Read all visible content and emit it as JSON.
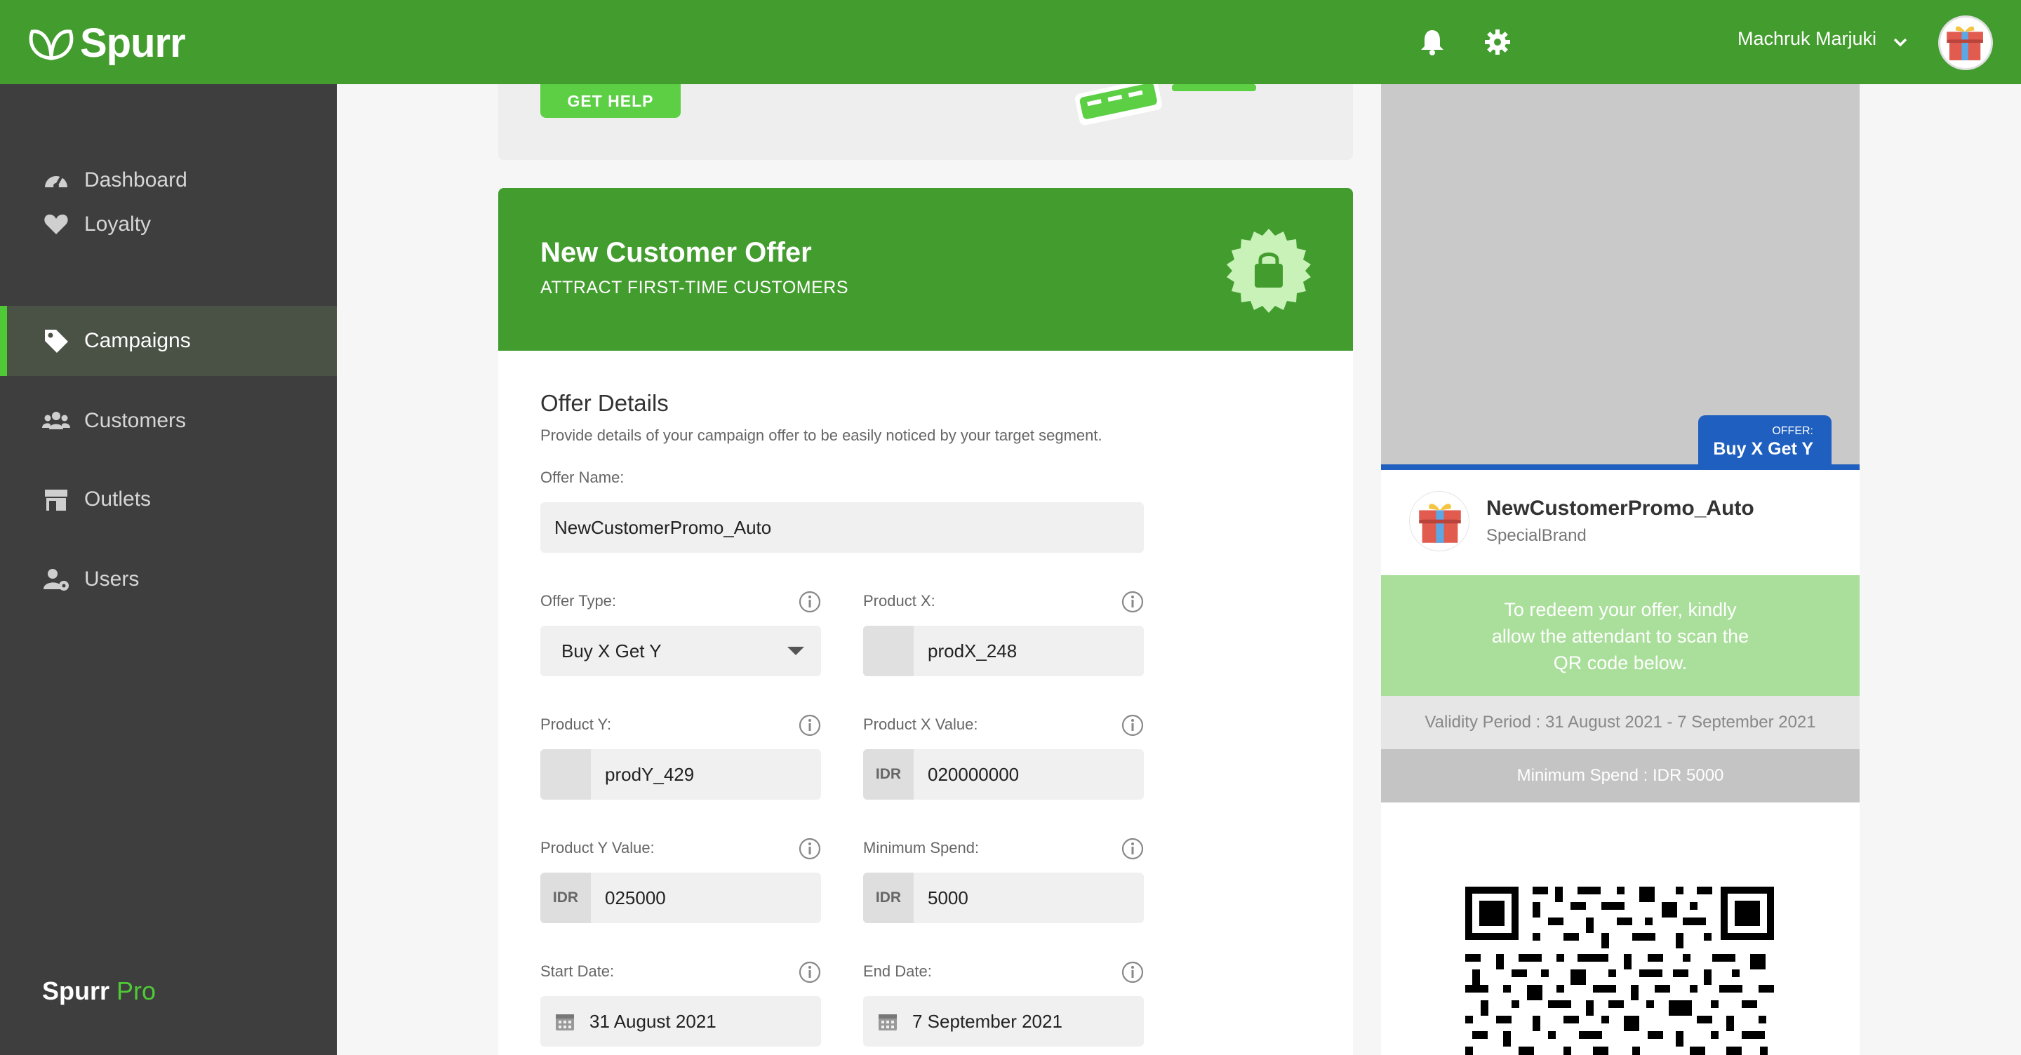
{
  "topbar": {
    "brand": "Spurr",
    "user_name": "Machruk Marjuki"
  },
  "sidebar": {
    "items": [
      {
        "label": "Dashboard",
        "icon": "speedometer-icon"
      },
      {
        "label": "Loyalty",
        "icon": "heart-icon"
      },
      {
        "label": "Campaigns",
        "icon": "tag-icon",
        "active": true
      },
      {
        "label": "Customers",
        "icon": "users-icon"
      },
      {
        "label": "Outlets",
        "icon": "store-icon"
      },
      {
        "label": "Users",
        "icon": "user-gear-icon"
      }
    ],
    "brand_main": "Spurr",
    "brand_pro": "Pro"
  },
  "help": {
    "button_label": "GET HELP"
  },
  "offer_header": {
    "title": "New Customer Offer",
    "subtitle": "ATTRACT FIRST-TIME CUSTOMERS"
  },
  "form": {
    "section_title": "Offer Details",
    "section_desc": "Provide details of your campaign offer to be easily noticed by your target segment.",
    "offer_name": {
      "label": "Offer Name:",
      "value": "NewCustomerPromo_Auto"
    },
    "offer_type": {
      "label": "Offer Type:",
      "value": "Buy X Get Y"
    },
    "product_x": {
      "label": "Product X:",
      "value": "prodX_248"
    },
    "product_y": {
      "label": "Product Y:",
      "value": "prodY_429"
    },
    "product_x_value": {
      "label": "Product X Value:",
      "prefix": "IDR",
      "value": "020000000"
    },
    "product_y_value": {
      "label": "Product Y Value:",
      "prefix": "IDR",
      "value": "025000"
    },
    "minimum_spend": {
      "label": "Minimum Spend:",
      "prefix": "IDR",
      "value": "5000"
    },
    "start_date": {
      "label": "Start Date:",
      "value": "31 August 2021"
    },
    "end_date": {
      "label": "End Date:",
      "value": "7 September 2021"
    }
  },
  "preview": {
    "offer_tag_small": "OFFER:",
    "offer_tag_big": "Buy X Get Y",
    "name": "NewCustomerPromo_Auto",
    "brand": "SpecialBrand",
    "redeem_text": "To redeem your offer, kindly allow the attendant to scan the QR code below.",
    "validity": "Validity Period : 31 August 2021 - 7 September 2021",
    "min_spend": "Minimum Spend : IDR 5000"
  },
  "colors": {
    "brand_green": "#439c2e",
    "accent_green": "#4fc936",
    "offer_blue": "#1f5fbf",
    "sidebar_bg": "#3e3e3e"
  }
}
